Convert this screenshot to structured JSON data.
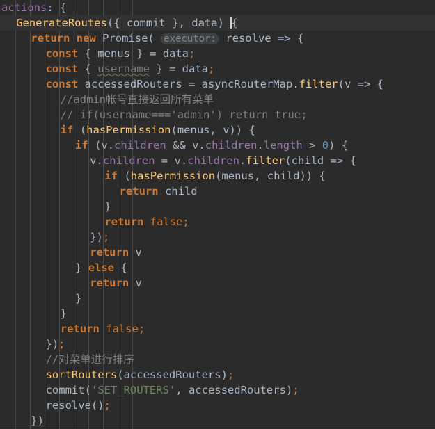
{
  "editor": {
    "language": "javascript",
    "theme": "darcula",
    "current_line_index": 1,
    "colors": {
      "background": "#2b2b2b",
      "current_line_background": "#323232",
      "indent_guide": "#4a4a4a",
      "keyword": "#cc7832",
      "function": "#ffc66d",
      "property": "#9876aa",
      "identifier": "#a9b7c6",
      "string": "#6a8759",
      "number": "#6897bb",
      "comment": "#808080",
      "unused_identifier": "#77797a",
      "inlay_hint_text": "#868a91",
      "inlay_hint_background": "#3b3f41",
      "caret": "#cfd2d4"
    },
    "indent_guide_positions": [
      22,
      43,
      64,
      85,
      106,
      127,
      148,
      169,
      190
    ]
  },
  "code": {
    "lines": [
      {
        "index": 0,
        "indent": 0,
        "tokens": [
          {
            "t": "actions",
            "c": "prop"
          },
          {
            "t": ":",
            "c": "punc"
          },
          {
            "t": " ",
            "c": "punc"
          },
          {
            "t": "{",
            "c": "brace"
          }
        ]
      },
      {
        "index": 1,
        "indent": 1,
        "current": true,
        "tokens": [
          {
            "t": "GenerateRoutes",
            "c": "fn"
          },
          {
            "t": "(",
            "c": "punc"
          },
          {
            "t": "{",
            "c": "brace"
          },
          {
            "t": " ",
            "c": "punc"
          },
          {
            "t": "commit",
            "c": "ident"
          },
          {
            "t": " ",
            "c": "punc"
          },
          {
            "t": "}",
            "c": "brace"
          },
          {
            "t": ",",
            "c": "punc"
          },
          {
            "t": " ",
            "c": "punc"
          },
          {
            "t": "data",
            "c": "ident"
          },
          {
            "t": ")",
            "c": "punc"
          },
          {
            "t": " ",
            "c": "punc"
          },
          {
            "t": "",
            "c": "caret"
          },
          {
            "t": "{",
            "c": "brace"
          }
        ]
      },
      {
        "index": 2,
        "indent": 2,
        "tokens": [
          {
            "t": "return",
            "c": "kw"
          },
          {
            "t": " ",
            "c": "punc"
          },
          {
            "t": "new",
            "c": "kw"
          },
          {
            "t": " ",
            "c": "punc"
          },
          {
            "t": "Promise",
            "c": "ident"
          },
          {
            "t": "(",
            "c": "punc"
          },
          {
            "t": " ",
            "c": "punc"
          },
          {
            "t": "executor:",
            "c": "inlay"
          },
          {
            "t": " ",
            "c": "punc"
          },
          {
            "t": "resolve",
            "c": "ident"
          },
          {
            "t": " ",
            "c": "punc"
          },
          {
            "t": "=>",
            "c": "op"
          },
          {
            "t": " ",
            "c": "punc"
          },
          {
            "t": "{",
            "c": "brace"
          }
        ]
      },
      {
        "index": 3,
        "indent": 3,
        "tokens": [
          {
            "t": "const",
            "c": "kw"
          },
          {
            "t": " ",
            "c": "punc"
          },
          {
            "t": "{",
            "c": "brace"
          },
          {
            "t": " ",
            "c": "punc"
          },
          {
            "t": "menus",
            "c": "ident"
          },
          {
            "t": " ",
            "c": "punc"
          },
          {
            "t": "}",
            "c": "brace"
          },
          {
            "t": " ",
            "c": "punc"
          },
          {
            "t": "=",
            "c": "op"
          },
          {
            "t": " ",
            "c": "punc"
          },
          {
            "t": "data",
            "c": "ident"
          },
          {
            "t": ";",
            "c": "semi"
          }
        ]
      },
      {
        "index": 4,
        "indent": 3,
        "tokens": [
          {
            "t": "const",
            "c": "kw"
          },
          {
            "t": " ",
            "c": "punc"
          },
          {
            "t": "{",
            "c": "brace"
          },
          {
            "t": " ",
            "c": "punc"
          },
          {
            "t": "username",
            "c": "unused"
          },
          {
            "t": " ",
            "c": "punc"
          },
          {
            "t": "}",
            "c": "brace"
          },
          {
            "t": " ",
            "c": "punc"
          },
          {
            "t": "=",
            "c": "op"
          },
          {
            "t": " ",
            "c": "punc"
          },
          {
            "t": "data",
            "c": "ident"
          },
          {
            "t": ";",
            "c": "semi"
          }
        ]
      },
      {
        "index": 5,
        "indent": 3,
        "tokens": [
          {
            "t": "const",
            "c": "kw"
          },
          {
            "t": " ",
            "c": "punc"
          },
          {
            "t": "accessedRouters",
            "c": "ident"
          },
          {
            "t": " ",
            "c": "punc"
          },
          {
            "t": "=",
            "c": "op"
          },
          {
            "t": " ",
            "c": "punc"
          },
          {
            "t": "asyncRouterMap",
            "c": "ident"
          },
          {
            "t": ".",
            "c": "punc"
          },
          {
            "t": "filter",
            "c": "fn"
          },
          {
            "t": "(",
            "c": "punc"
          },
          {
            "t": "v",
            "c": "ident"
          },
          {
            "t": " ",
            "c": "punc"
          },
          {
            "t": "=>",
            "c": "op"
          },
          {
            "t": " ",
            "c": "punc"
          },
          {
            "t": "{",
            "c": "brace"
          }
        ]
      },
      {
        "index": 6,
        "indent": 4,
        "tokens": [
          {
            "t": "//admin",
            "c": "cmt"
          },
          {
            "t": "帐号直接返回所有菜单",
            "c": "cmt cjk"
          }
        ]
      },
      {
        "index": 7,
        "indent": 4,
        "tokens": [
          {
            "t": "// if(username==='admin') return true;",
            "c": "cmt"
          }
        ]
      },
      {
        "index": 8,
        "indent": 4,
        "tokens": [
          {
            "t": "if",
            "c": "kw"
          },
          {
            "t": " ",
            "c": "punc"
          },
          {
            "t": "(",
            "c": "punc"
          },
          {
            "t": "hasPermission",
            "c": "fn"
          },
          {
            "t": "(",
            "c": "punc"
          },
          {
            "t": "menus",
            "c": "ident"
          },
          {
            "t": ",",
            "c": "punc"
          },
          {
            "t": " ",
            "c": "punc"
          },
          {
            "t": "v",
            "c": "ident"
          },
          {
            "t": "))",
            "c": "punc"
          },
          {
            "t": " ",
            "c": "punc"
          },
          {
            "t": "{",
            "c": "brace"
          }
        ]
      },
      {
        "index": 9,
        "indent": 5,
        "tokens": [
          {
            "t": "if",
            "c": "kw"
          },
          {
            "t": " ",
            "c": "punc"
          },
          {
            "t": "(",
            "c": "punc"
          },
          {
            "t": "v",
            "c": "ident"
          },
          {
            "t": ".",
            "c": "punc"
          },
          {
            "t": "children",
            "c": "prop"
          },
          {
            "t": " ",
            "c": "punc"
          },
          {
            "t": "&&",
            "c": "op"
          },
          {
            "t": " ",
            "c": "punc"
          },
          {
            "t": "v",
            "c": "ident"
          },
          {
            "t": ".",
            "c": "punc"
          },
          {
            "t": "children",
            "c": "prop"
          },
          {
            "t": ".",
            "c": "punc"
          },
          {
            "t": "length",
            "c": "prop"
          },
          {
            "t": " ",
            "c": "punc"
          },
          {
            "t": ">",
            "c": "op"
          },
          {
            "t": " ",
            "c": "punc"
          },
          {
            "t": "0",
            "c": "num"
          },
          {
            "t": ")",
            "c": "punc"
          },
          {
            "t": " ",
            "c": "punc"
          },
          {
            "t": "{",
            "c": "brace"
          }
        ]
      },
      {
        "index": 10,
        "indent": 6,
        "tokens": [
          {
            "t": "v",
            "c": "ident"
          },
          {
            "t": ".",
            "c": "punc"
          },
          {
            "t": "children",
            "c": "prop"
          },
          {
            "t": " ",
            "c": "punc"
          },
          {
            "t": "=",
            "c": "op"
          },
          {
            "t": " ",
            "c": "punc"
          },
          {
            "t": "v",
            "c": "ident"
          },
          {
            "t": ".",
            "c": "punc"
          },
          {
            "t": "children",
            "c": "prop"
          },
          {
            "t": ".",
            "c": "punc"
          },
          {
            "t": "filter",
            "c": "fn"
          },
          {
            "t": "(",
            "c": "punc"
          },
          {
            "t": "child",
            "c": "ident"
          },
          {
            "t": " ",
            "c": "punc"
          },
          {
            "t": "=>",
            "c": "op"
          },
          {
            "t": " ",
            "c": "punc"
          },
          {
            "t": "{",
            "c": "brace"
          }
        ]
      },
      {
        "index": 11,
        "indent": 7,
        "tokens": [
          {
            "t": "if",
            "c": "kw"
          },
          {
            "t": " ",
            "c": "punc"
          },
          {
            "t": "(",
            "c": "punc"
          },
          {
            "t": "hasPermission",
            "c": "fn"
          },
          {
            "t": "(",
            "c": "punc"
          },
          {
            "t": "menus",
            "c": "ident"
          },
          {
            "t": ",",
            "c": "punc"
          },
          {
            "t": " ",
            "c": "punc"
          },
          {
            "t": "child",
            "c": "ident"
          },
          {
            "t": "))",
            "c": "punc"
          },
          {
            "t": " ",
            "c": "punc"
          },
          {
            "t": "{",
            "c": "brace"
          }
        ]
      },
      {
        "index": 12,
        "indent": 8,
        "tokens": [
          {
            "t": "return",
            "c": "kw"
          },
          {
            "t": " ",
            "c": "punc"
          },
          {
            "t": "child",
            "c": "ident"
          }
        ]
      },
      {
        "index": 13,
        "indent": 7,
        "tokens": [
          {
            "t": "}",
            "c": "brace"
          }
        ]
      },
      {
        "index": 14,
        "indent": 7,
        "tokens": [
          {
            "t": "return",
            "c": "kw"
          },
          {
            "t": " ",
            "c": "punc"
          },
          {
            "t": "false",
            "c": "kw-plain"
          },
          {
            "t": ";",
            "c": "semi"
          }
        ]
      },
      {
        "index": 15,
        "indent": 6,
        "tokens": [
          {
            "t": "})",
            "c": "brace"
          },
          {
            "t": ";",
            "c": "semi"
          }
        ]
      },
      {
        "index": 16,
        "indent": 6,
        "tokens": [
          {
            "t": "return",
            "c": "kw"
          },
          {
            "t": " ",
            "c": "punc"
          },
          {
            "t": "v",
            "c": "ident"
          }
        ]
      },
      {
        "index": 17,
        "indent": 5,
        "tokens": [
          {
            "t": "}",
            "c": "brace"
          },
          {
            "t": " ",
            "c": "punc"
          },
          {
            "t": "else",
            "c": "kw"
          },
          {
            "t": " ",
            "c": "punc"
          },
          {
            "t": "{",
            "c": "brace"
          }
        ]
      },
      {
        "index": 18,
        "indent": 6,
        "tokens": [
          {
            "t": "return",
            "c": "kw"
          },
          {
            "t": " ",
            "c": "punc"
          },
          {
            "t": "v",
            "c": "ident"
          }
        ]
      },
      {
        "index": 19,
        "indent": 5,
        "tokens": [
          {
            "t": "}",
            "c": "brace"
          }
        ]
      },
      {
        "index": 20,
        "indent": 4,
        "tokens": [
          {
            "t": "}",
            "c": "brace"
          }
        ]
      },
      {
        "index": 21,
        "indent": 4,
        "tokens": [
          {
            "t": "return",
            "c": "kw"
          },
          {
            "t": " ",
            "c": "punc"
          },
          {
            "t": "false",
            "c": "kw-plain"
          },
          {
            "t": ";",
            "c": "semi"
          }
        ]
      },
      {
        "index": 22,
        "indent": 3,
        "tokens": [
          {
            "t": "})",
            "c": "brace"
          },
          {
            "t": ";",
            "c": "semi"
          }
        ]
      },
      {
        "index": 23,
        "indent": 3,
        "tokens": [
          {
            "t": "//",
            "c": "cmt"
          },
          {
            "t": "对菜单进行排序",
            "c": "cmt cjk"
          }
        ]
      },
      {
        "index": 24,
        "indent": 3,
        "tokens": [
          {
            "t": "sortRouters",
            "c": "fn"
          },
          {
            "t": "(",
            "c": "punc"
          },
          {
            "t": "accessedRouters",
            "c": "ident"
          },
          {
            "t": ")",
            "c": "punc"
          },
          {
            "t": ";",
            "c": "semi"
          }
        ]
      },
      {
        "index": 25,
        "indent": 3,
        "tokens": [
          {
            "t": "commit",
            "c": "ident"
          },
          {
            "t": "(",
            "c": "punc"
          },
          {
            "t": "'SET_ROUTERS'",
            "c": "str"
          },
          {
            "t": ",",
            "c": "punc"
          },
          {
            "t": " ",
            "c": "punc"
          },
          {
            "t": "accessedRouters",
            "c": "ident"
          },
          {
            "t": ")",
            "c": "punc"
          },
          {
            "t": ";",
            "c": "semi"
          }
        ]
      },
      {
        "index": 26,
        "indent": 3,
        "tokens": [
          {
            "t": "resolve",
            "c": "ident"
          },
          {
            "t": "(",
            "c": "punc"
          },
          {
            "t": ")",
            "c": "punc"
          },
          {
            "t": ";",
            "c": "semi"
          }
        ]
      },
      {
        "index": 27,
        "indent": 2,
        "tokens": [
          {
            "t": "})",
            "c": "brace"
          }
        ]
      }
    ]
  }
}
